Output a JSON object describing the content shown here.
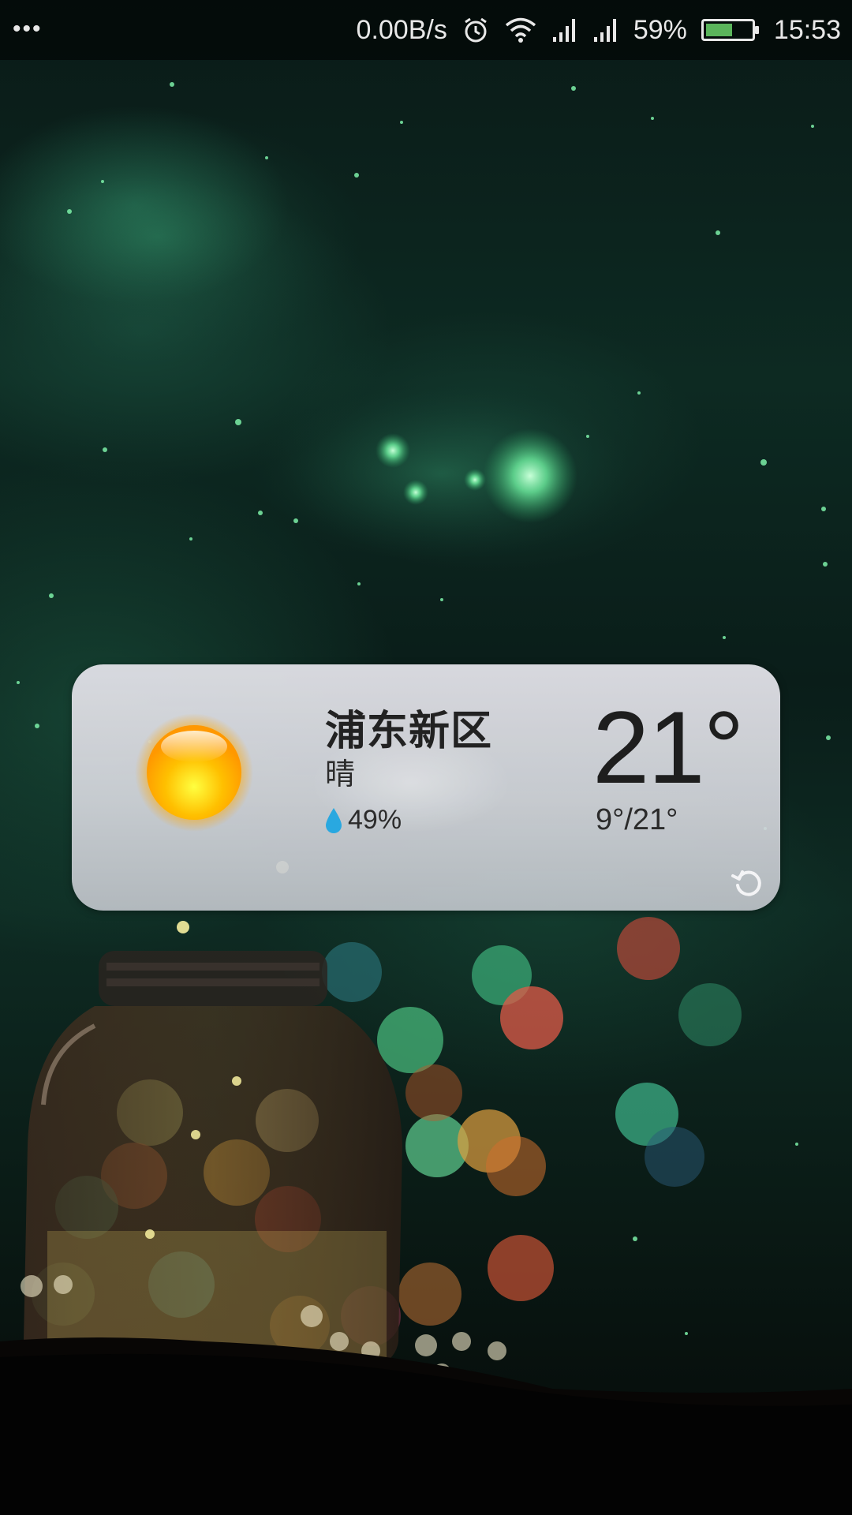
{
  "status_bar": {
    "more_icon": "more-dots-icon",
    "network_speed": "0.00B/s",
    "battery_percent": "59%",
    "battery_level": 0.59,
    "time": "15:53",
    "icons": [
      "alarm-icon",
      "wifi-icon",
      "signal-icon",
      "signal-icon",
      "battery-icon"
    ],
    "battery_color": "#5bb55b"
  },
  "weather_widget": {
    "city": "浦东新区",
    "condition": "晴",
    "condition_icon": "sun-icon",
    "humidity": "49%",
    "humidity_icon": "water-drop-icon",
    "temperature": "21°",
    "range": "9°/21°",
    "refresh_icon": "refresh-icon",
    "accent_drop_color": "#29a8e0"
  },
  "wallpaper": {
    "description_icon": "firefly-jar-wallpaper"
  }
}
